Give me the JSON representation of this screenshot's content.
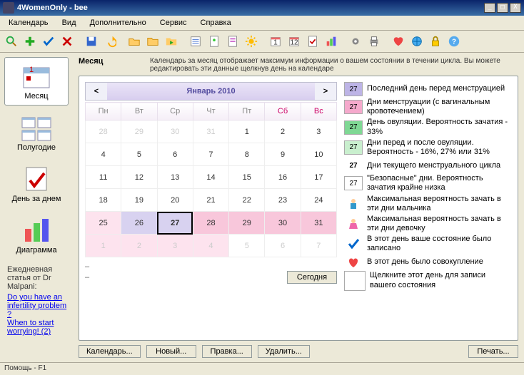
{
  "window": {
    "title": "4WomenOnly - bee"
  },
  "menu": {
    "items": [
      "Календарь",
      "Вид",
      "Дополнительно",
      "Сервис",
      "Справка"
    ]
  },
  "sidebar": {
    "items": [
      {
        "label": "Месяц"
      },
      {
        "label": "Полугодие"
      },
      {
        "label": "День за днем"
      },
      {
        "label": "Диаграмма"
      }
    ],
    "article_heading": "Ежедневная статья от Dr Malpani:",
    "links": [
      "Do you have an infertility problem ?",
      "When to start worrying! (2)"
    ]
  },
  "header": {
    "title": "Месяц",
    "desc": "Календарь за месяц отображает максимум информации о вашем состоянии в течении цикла. Вы можете редактировать эти данные щелкнув день на календаре"
  },
  "calendar": {
    "nav_prev": "<",
    "nav_next": ">",
    "month_title": "Январь 2010",
    "weekdays": [
      "Пн",
      "Вт",
      "Ср",
      "Чт",
      "Пт",
      "Сб",
      "Вс"
    ],
    "rows": [
      [
        {
          "d": "28",
          "cls": "other"
        },
        {
          "d": "29",
          "cls": "other"
        },
        {
          "d": "30",
          "cls": "other"
        },
        {
          "d": "31",
          "cls": "other"
        },
        {
          "d": "1",
          "cls": ""
        },
        {
          "d": "2",
          "cls": ""
        },
        {
          "d": "3",
          "cls": ""
        }
      ],
      [
        {
          "d": "4",
          "cls": ""
        },
        {
          "d": "5",
          "cls": ""
        },
        {
          "d": "6",
          "cls": ""
        },
        {
          "d": "7",
          "cls": ""
        },
        {
          "d": "8",
          "cls": ""
        },
        {
          "d": "9",
          "cls": ""
        },
        {
          "d": "10",
          "cls": ""
        }
      ],
      [
        {
          "d": "11",
          "cls": ""
        },
        {
          "d": "12",
          "cls": ""
        },
        {
          "d": "13",
          "cls": ""
        },
        {
          "d": "14",
          "cls": ""
        },
        {
          "d": "15",
          "cls": ""
        },
        {
          "d": "16",
          "cls": ""
        },
        {
          "d": "17",
          "cls": ""
        }
      ],
      [
        {
          "d": "18",
          "cls": ""
        },
        {
          "d": "19",
          "cls": ""
        },
        {
          "d": "20",
          "cls": ""
        },
        {
          "d": "21",
          "cls": ""
        },
        {
          "d": "22",
          "cls": ""
        },
        {
          "d": "23",
          "cls": ""
        },
        {
          "d": "24",
          "cls": ""
        }
      ],
      [
        {
          "d": "25",
          "cls": "lpink"
        },
        {
          "d": "26",
          "cls": "lav"
        },
        {
          "d": "27",
          "cls": "today"
        },
        {
          "d": "28",
          "cls": "pink"
        },
        {
          "d": "29",
          "cls": "pink"
        },
        {
          "d": "30",
          "cls": "pink"
        },
        {
          "d": "31",
          "cls": "pink"
        }
      ],
      [
        {
          "d": "1",
          "cls": "other lpink"
        },
        {
          "d": "2",
          "cls": "other lpink"
        },
        {
          "d": "3",
          "cls": "other lpink"
        },
        {
          "d": "4",
          "cls": "other lpink"
        },
        {
          "d": "5",
          "cls": "other"
        },
        {
          "d": "6",
          "cls": "other"
        },
        {
          "d": "7",
          "cls": "other"
        }
      ]
    ],
    "today_btn": "Сегодня"
  },
  "buttons": {
    "calendar": "Календарь...",
    "new": "Новый...",
    "edit": "Правка...",
    "delete": "Удалить...",
    "print": "Печать..."
  },
  "legend": {
    "items": [
      {
        "n": "27",
        "sw": "sw-lav",
        "text": "Последний день перед менструацией"
      },
      {
        "n": "27",
        "sw": "sw-pink",
        "text": "Дни менструации (с вагинальным кровотечением)"
      },
      {
        "n": "27",
        "sw": "sw-green",
        "text": "День овуляции. Вероятность зачатия - 33%"
      },
      {
        "n": "27",
        "sw": "sw-lgreen",
        "text": "Дни перед и после овуляции. Вероятность - 16%, 27% или 31%"
      },
      {
        "n": "27",
        "sw": "sw-bold",
        "text": "Дни текущего менструального цикла"
      },
      {
        "n": "27",
        "sw": "sw-white",
        "text": "\"Безопасные\" дни. Вероятность зачатия крайне низка"
      },
      {
        "n": "",
        "sw": "sw-icon",
        "icon": "boy",
        "text": "Максимальная вероятность зачать в эти дни мальчика"
      },
      {
        "n": "",
        "sw": "sw-icon",
        "icon": "girl",
        "text": "Максимальная вероятность зачать в эти дни девочку"
      },
      {
        "n": "",
        "sw": "sw-icon",
        "icon": "check",
        "text": "В этот день ваше состояние было записано"
      },
      {
        "n": "",
        "sw": "sw-icon",
        "icon": "heart",
        "text": "В этот день было совокупление"
      },
      {
        "n": "",
        "sw": "sw-white big",
        "text": "Щелкните этот день для записи вашего состояния"
      }
    ]
  },
  "status": "Помощь - F1"
}
